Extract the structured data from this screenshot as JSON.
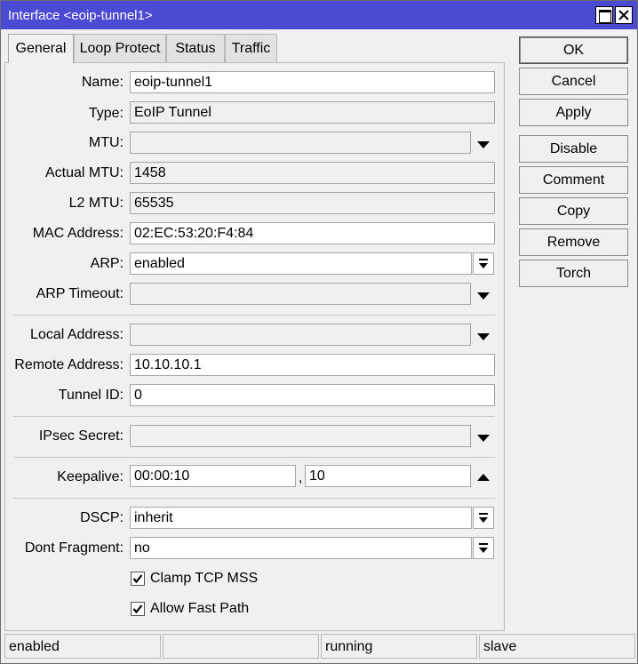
{
  "window": {
    "title": "Interface <eoip-tunnel1>"
  },
  "tabs": [
    {
      "label": "General",
      "active": true
    },
    {
      "label": "Loop Protect",
      "active": false
    },
    {
      "label": "Status",
      "active": false
    },
    {
      "label": "Traffic",
      "active": false
    }
  ],
  "general": {
    "name": {
      "label": "Name:",
      "value": "eoip-tunnel1"
    },
    "type": {
      "label": "Type:",
      "value": "EoIP Tunnel"
    },
    "mtu": {
      "label": "MTU:",
      "value": ""
    },
    "actual_mtu": {
      "label": "Actual MTU:",
      "value": "1458"
    },
    "l2_mtu": {
      "label": "L2 MTU:",
      "value": "65535"
    },
    "mac_address": {
      "label": "MAC Address:",
      "value": "02:EC:53:20:F4:84"
    },
    "arp": {
      "label": "ARP:",
      "value": "enabled"
    },
    "arp_timeout": {
      "label": "ARP Timeout:",
      "value": ""
    },
    "local_address": {
      "label": "Local Address:",
      "value": ""
    },
    "remote_address": {
      "label": "Remote Address:",
      "value": "10.10.10.1"
    },
    "tunnel_id": {
      "label": "Tunnel ID:",
      "value": "0"
    },
    "ipsec_secret": {
      "label": "IPsec Secret:",
      "value": ""
    },
    "keepalive": {
      "label": "Keepalive:",
      "interval": "00:00:10",
      "separator": ",",
      "retries": "10"
    },
    "dscp": {
      "label": "DSCP:",
      "value": "inherit"
    },
    "dont_fragment": {
      "label": "Dont Fragment:",
      "value": "no"
    },
    "clamp_tcp_mss": {
      "label": "Clamp TCP MSS",
      "checked": true
    },
    "allow_fast_path": {
      "label": "Allow Fast Path",
      "checked": true
    }
  },
  "buttons": {
    "ok": "OK",
    "cancel": "Cancel",
    "apply": "Apply",
    "disable": "Disable",
    "comment": "Comment",
    "copy": "Copy",
    "remove": "Remove",
    "torch": "Torch"
  },
  "status": [
    "enabled",
    "",
    "running",
    "slave"
  ],
  "colors": {
    "titlebar": "#4a4ad2",
    "background": "#f0f0f0"
  }
}
